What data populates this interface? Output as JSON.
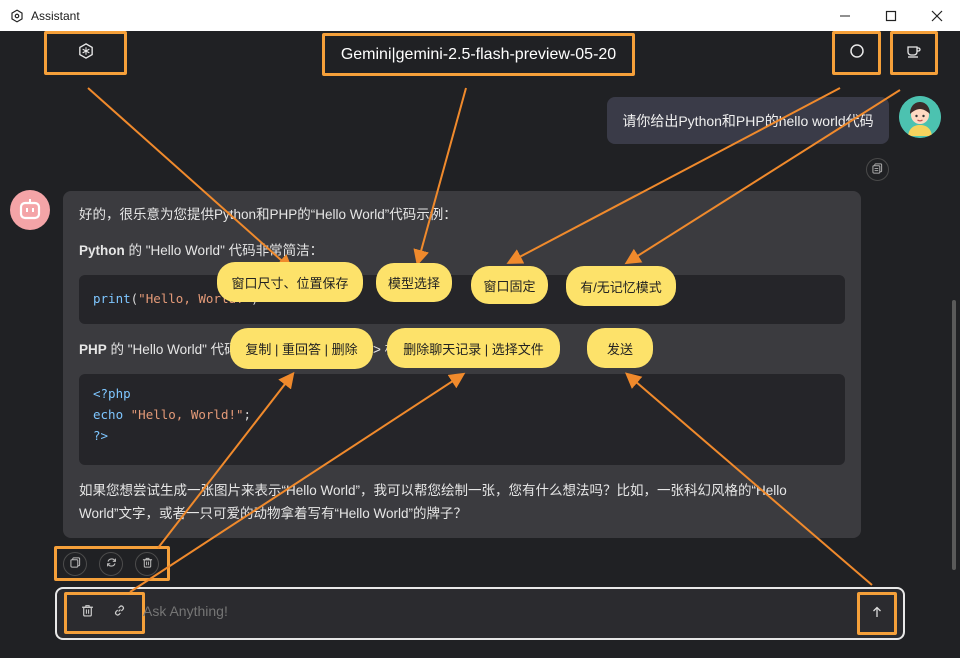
{
  "window": {
    "title": "Assistant"
  },
  "header": {
    "model_label": "Gemini|gemini-2.5-flash-preview-05-20"
  },
  "user_message": {
    "text": "请你给出Python和PHP的hello world代码"
  },
  "bot_message": {
    "intro": "好的，很乐意为您提供Python和PHP的“Hello World”代码示例：",
    "python_heading_bold": "Python",
    "python_heading_rest": " 的 \"Hello World\" 代码非常简洁：",
    "python_code": {
      "fn": "print",
      "open": "(",
      "str": "\"Hello, World!\"",
      "close": ")"
    },
    "php_heading_bold": "PHP",
    "php_heading_rest": " 的 \"Hello World\" 代码需要包含在 <?php ... ?> 标签中：",
    "php_code": {
      "line1": "<?php",
      "line2_kw": "echo",
      "line2_str": "\"Hello, World!\"",
      "line2_end": ";",
      "line3": "?>"
    },
    "outro": "如果您想尝试生成一张图片来表示“Hello World”，我可以帮您绘制一张，您有什么想法吗？比如，一张科幻风格的“Hello World”文字，或者一只可爱的动物拿着写有“Hello World”的牌子？"
  },
  "input": {
    "placeholder": "Ask Anything!"
  },
  "annotations": {
    "window_save": "窗口尺寸、位置保存",
    "model_select": "模型选择",
    "window_pin": "窗口固定",
    "memory_mode": "有/无记忆模式",
    "copy_retry_delete": "复制 | 重回答 | 删除",
    "clear_history_file": "删除聊天记录 | 选择文件",
    "send": "发送"
  },
  "colors": {
    "accent_orange": "#f5a03a",
    "callout_yellow": "#fde26a",
    "background": "#202124"
  },
  "icons": [
    "openai-logo-icon",
    "circle-pin-icon",
    "coffee-cup-icon",
    "copy-icon",
    "refresh-icon",
    "trash-icon",
    "link-icon",
    "arrow-up-icon",
    "robot-avatar-icon",
    "user-avatar-icon"
  ]
}
